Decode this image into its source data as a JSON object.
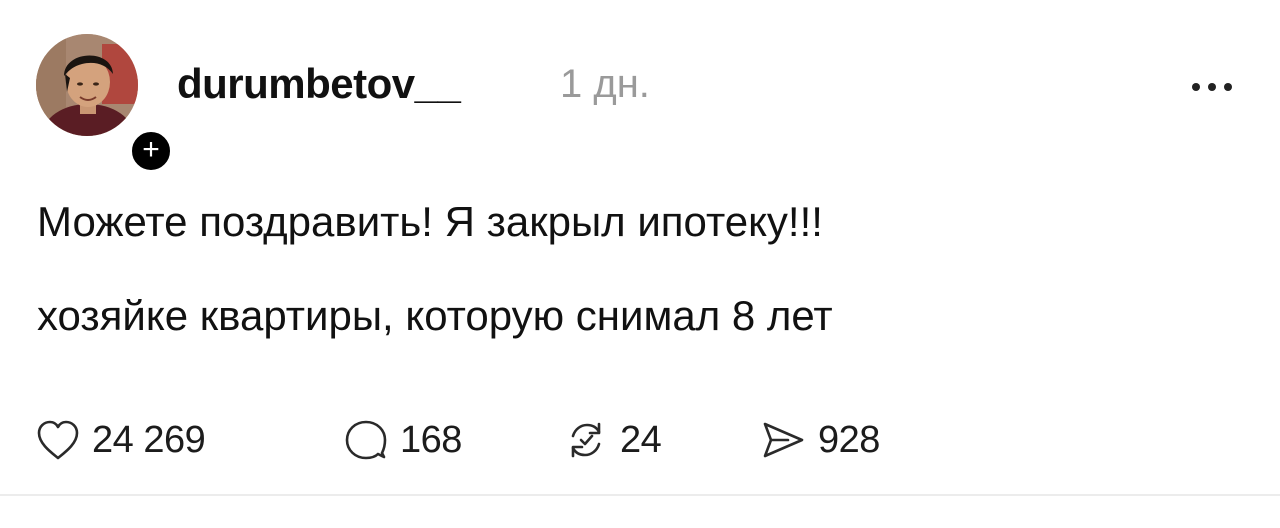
{
  "post": {
    "username": "durumbetov__",
    "time": "1 дн.",
    "text_lines": [
      "Можете поздравить! Я закрыл ипотеку!!!",
      "хозяйке квартиры, которую снимал 8 лет"
    ],
    "follow_symbol": "+"
  },
  "actions": {
    "likes": {
      "icon": "heart-icon",
      "count": "24 269"
    },
    "comments": {
      "icon": "comment-icon",
      "count": "168"
    },
    "reposts": {
      "icon": "repost-icon",
      "count": "24"
    },
    "shares": {
      "icon": "send-icon",
      "count": "928"
    }
  },
  "menu": {
    "icon": "more-dots-icon"
  },
  "colors": {
    "text": "#111111",
    "muted": "#9a9a9a",
    "divider": "#ececec",
    "badge": "#000000"
  }
}
